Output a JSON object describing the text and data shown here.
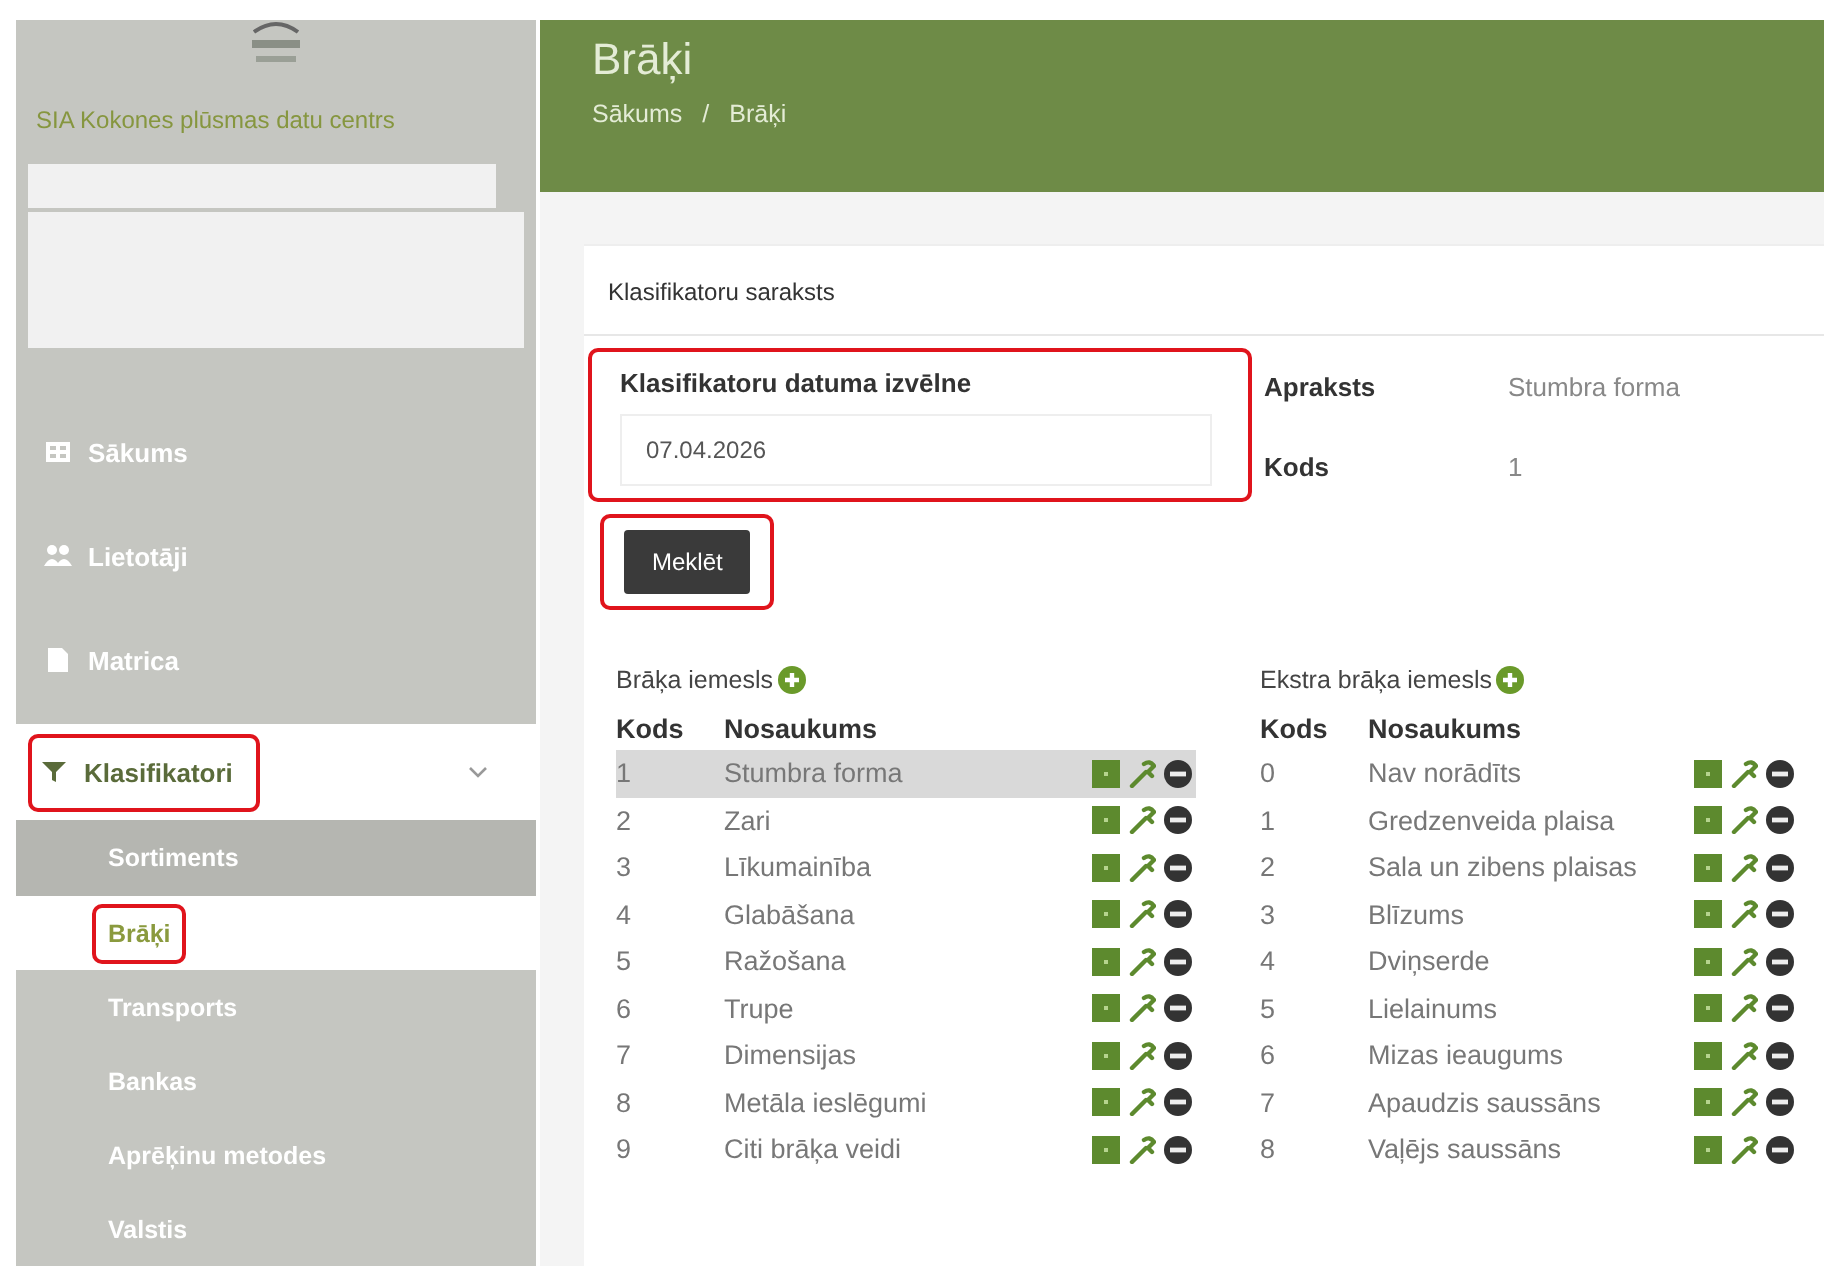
{
  "sidebar": {
    "organization": "SIA Kokones plūsmas datu centrs",
    "nav": [
      {
        "label": "Sākums",
        "kind": "home",
        "selected": false,
        "highlighted": false
      },
      {
        "label": "Lietotāji",
        "kind": "users",
        "selected": false,
        "highlighted": false
      },
      {
        "label": "Matrica",
        "kind": "document",
        "selected": false,
        "highlighted": false
      },
      {
        "label": "Klasifikatori",
        "kind": "filter",
        "selected": true,
        "highlighted": true,
        "expanded": true,
        "children": [
          {
            "label": "Sortiments",
            "selected": false,
            "highlighted": false
          },
          {
            "label": "Brāķi",
            "selected": true,
            "highlighted": true
          },
          {
            "label": "Transports",
            "selected": false,
            "highlighted": false
          },
          {
            "label": "Bankas",
            "selected": false,
            "highlighted": false
          },
          {
            "label": "Aprēķinu metodes",
            "selected": false,
            "highlighted": false
          },
          {
            "label": "Valstis",
            "selected": false,
            "highlighted": false
          }
        ]
      }
    ]
  },
  "header": {
    "title": "Brāķi",
    "breadcrumbs": [
      "Sākums",
      "Brāķi"
    ],
    "breadcrumb_separator": "/"
  },
  "card": {
    "title": "Klasifikatoru saraksts",
    "date_picker": {
      "label": "Klasifikatoru datuma izvēlne",
      "value": "07.04.2026",
      "highlighted": true
    },
    "details": [
      {
        "label": "Apraksts",
        "value": "Stumbra forma"
      },
      {
        "label": "Kods",
        "value": "1"
      }
    ],
    "search_button": {
      "label": "Meklēt",
      "highlighted": true
    },
    "tables": [
      {
        "title": "Brāķa iemesls",
        "columns": [
          "Kods",
          "Nosaukums"
        ],
        "rows": [
          {
            "code": "1",
            "name": "Stumbra forma",
            "selected": true
          },
          {
            "code": "2",
            "name": "Zari",
            "selected": false
          },
          {
            "code": "3",
            "name": "Līkumainība",
            "selected": false
          },
          {
            "code": "4",
            "name": "Glabāšana",
            "selected": false
          },
          {
            "code": "5",
            "name": "Ražošana",
            "selected": false
          },
          {
            "code": "6",
            "name": "Trupe",
            "selected": false
          },
          {
            "code": "7",
            "name": "Dimensijas",
            "selected": false
          },
          {
            "code": "8",
            "name": "Metāla ieslēgumi",
            "selected": false
          },
          {
            "code": "9",
            "name": "Citi brāķa veidi",
            "selected": false
          }
        ]
      },
      {
        "title": "Ekstra brāķa iemesls",
        "columns": [
          "Kods",
          "Nosaukums"
        ],
        "rows": [
          {
            "code": "0",
            "name": "Nav norādīts",
            "selected": false
          },
          {
            "code": "1",
            "name": "Gredzenveida plaisa",
            "selected": false
          },
          {
            "code": "2",
            "name": "Sala un zibens plaisas",
            "selected": false
          },
          {
            "code": "3",
            "name": "Blīzums",
            "selected": false
          },
          {
            "code": "4",
            "name": "Dviņserde",
            "selected": false
          },
          {
            "code": "5",
            "name": "Lielainums",
            "selected": false
          },
          {
            "code": "6",
            "name": "Mizas ieaugums",
            "selected": false
          },
          {
            "code": "7",
            "name": "Apaudzis saussāns",
            "selected": false
          },
          {
            "code": "8",
            "name": "Vaļējs saussāns",
            "selected": false
          }
        ]
      }
    ]
  }
}
